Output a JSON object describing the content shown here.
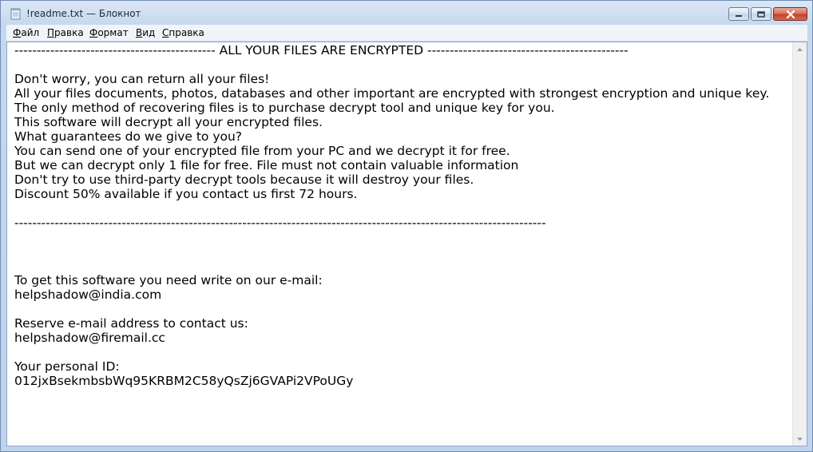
{
  "window": {
    "title": "!readme.txt — Блокнот"
  },
  "menu": [
    {
      "label": "Файл",
      "accel": "Ф",
      "rest": "айл"
    },
    {
      "label": "Правка",
      "accel": "П",
      "rest": "равка"
    },
    {
      "label": "Формат",
      "accel": "Ф",
      "rest": "ормат"
    },
    {
      "label": "Вид",
      "accel": "В",
      "rest": "ид"
    },
    {
      "label": "Справка",
      "accel": "С",
      "rest": "правка"
    }
  ],
  "document": {
    "lines": [
      "--------------------------------------------- ALL YOUR FILES ARE ENCRYPTED ---------------------------------------------",
      "",
      "Don't worry, you can return all your files!",
      "All your files documents, photos, databases and other important are encrypted with strongest encryption and unique key.",
      "The only method of recovering files is to purchase decrypt tool and unique key for you.",
      "This software will decrypt all your encrypted files.",
      "What guarantees do we give to you?",
      "You can send one of your encrypted file from your PC and we decrypt it for free.",
      "But we can decrypt only 1 file for free. File must not contain valuable information",
      "Don't try to use third-party decrypt tools because it will destroy your files.",
      "Discount 50% available if you contact us first 72 hours.",
      "",
      "-----------------------------------------------------------------------------------------------------------------------",
      "",
      "",
      "",
      "To get this software you need write on our e-mail:",
      "helpshadow@india.com",
      "",
      "Reserve e-mail address to contact us:",
      "helpshadow@firemail.cc",
      "",
      "Your personal ID:",
      "012jxBsekmbsbWq95KRBM2C58yQsZj6GVAPi2VPoUGy"
    ]
  },
  "icons": {
    "app": "notepad-icon",
    "minimize": "minimize-icon",
    "maximize": "maximize-icon",
    "close": "close-icon",
    "scroll_up": "scroll-up-icon",
    "scroll_down": "scroll-down-icon"
  }
}
